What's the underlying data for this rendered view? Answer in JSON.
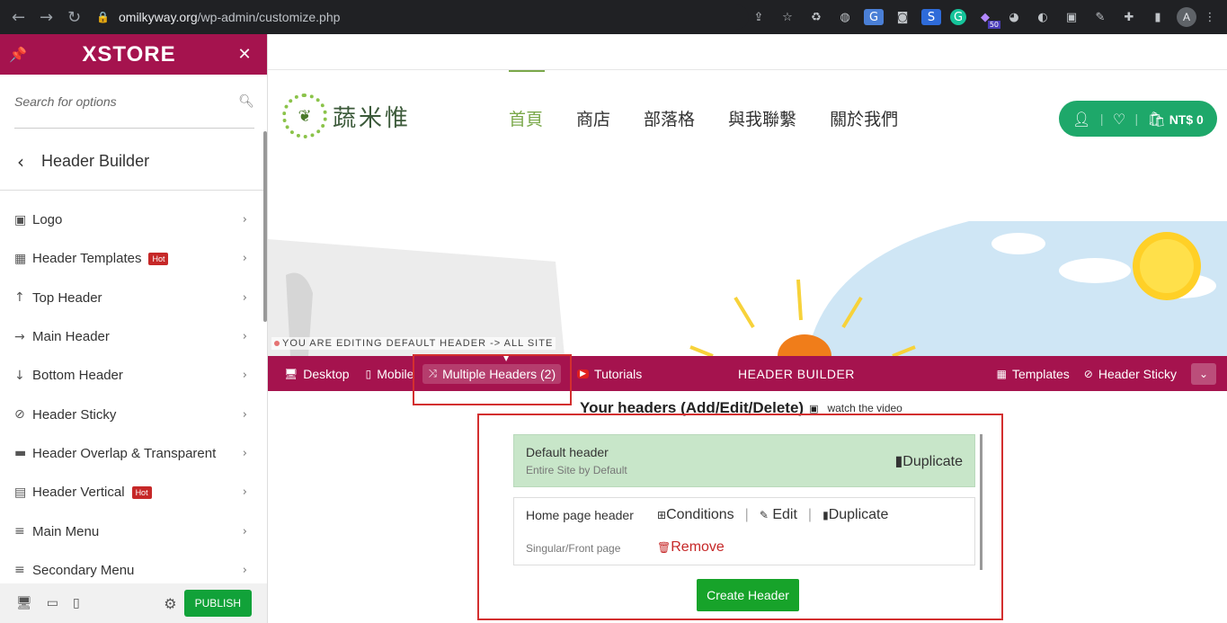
{
  "browser": {
    "url_domain": "omilkyway.org",
    "url_path": "/wp-admin/customize.php",
    "avatar_letter": "A",
    "ext_badge": "50"
  },
  "sidebar": {
    "brand": "XSTORE",
    "search_placeholder": "Search for options",
    "back_title": "Header Builder",
    "hot_label": "Hot",
    "items": [
      {
        "label": "Logo",
        "icon": "image-icon",
        "hot": false
      },
      {
        "label": "Header Templates",
        "icon": "grid-icon",
        "hot": true
      },
      {
        "label": "Top Header",
        "icon": "arrow-up-icon",
        "hot": false
      },
      {
        "label": "Main Header",
        "icon": "arrow-right-icon",
        "hot": false
      },
      {
        "label": "Bottom Header",
        "icon": "arrow-down-icon",
        "hot": false
      },
      {
        "label": "Header Sticky",
        "icon": "paperclip-icon",
        "hot": false
      },
      {
        "label": "Header Overlap & Transparent",
        "icon": "layers-icon",
        "hot": false
      },
      {
        "label": "Header Vertical",
        "icon": "document-icon",
        "hot": true
      },
      {
        "label": "Main Menu",
        "icon": "menu-icon",
        "hot": false
      },
      {
        "label": "Secondary Menu",
        "icon": "menu-icon",
        "hot": false
      }
    ],
    "publish_label": "PUBLISH"
  },
  "preview": {
    "logo_text": "蔬米惟",
    "nav": [
      "首頁",
      "商店",
      "部落格",
      "與我聯繫",
      "關於我們"
    ],
    "cart_amount": "NT$ 0",
    "editing_label": "YOU ARE EDITING DEFAULT HEADER -> ALL SITE",
    "hb_bar": {
      "desktop": "Desktop",
      "mobile": "Mobile",
      "multiple_headers": "Multiple Headers (2)",
      "tutorials": "Tutorials",
      "title": "HEADER BUILDER",
      "templates": "Templates",
      "header_sticky": "Header Sticky"
    },
    "your_headers_title": "Your headers (Add/Edit/Delete)",
    "watch_video": "watch the video",
    "headers": {
      "default": {
        "name": "Default header",
        "sub": "Entire Site by Default",
        "duplicate": "Duplicate"
      },
      "home": {
        "name": "Home page header",
        "sub": "Singular/Front page",
        "conditions": "Conditions",
        "edit": "Edit",
        "duplicate": "Duplicate",
        "remove": "Remove"
      }
    },
    "create_button": "Create Header"
  },
  "colors": {
    "brand": "#a5134e",
    "green_accent": "#1ea86a",
    "publish_green": "#11a239",
    "create_green": "#17a32a",
    "highlight_red": "#d32f2f"
  }
}
